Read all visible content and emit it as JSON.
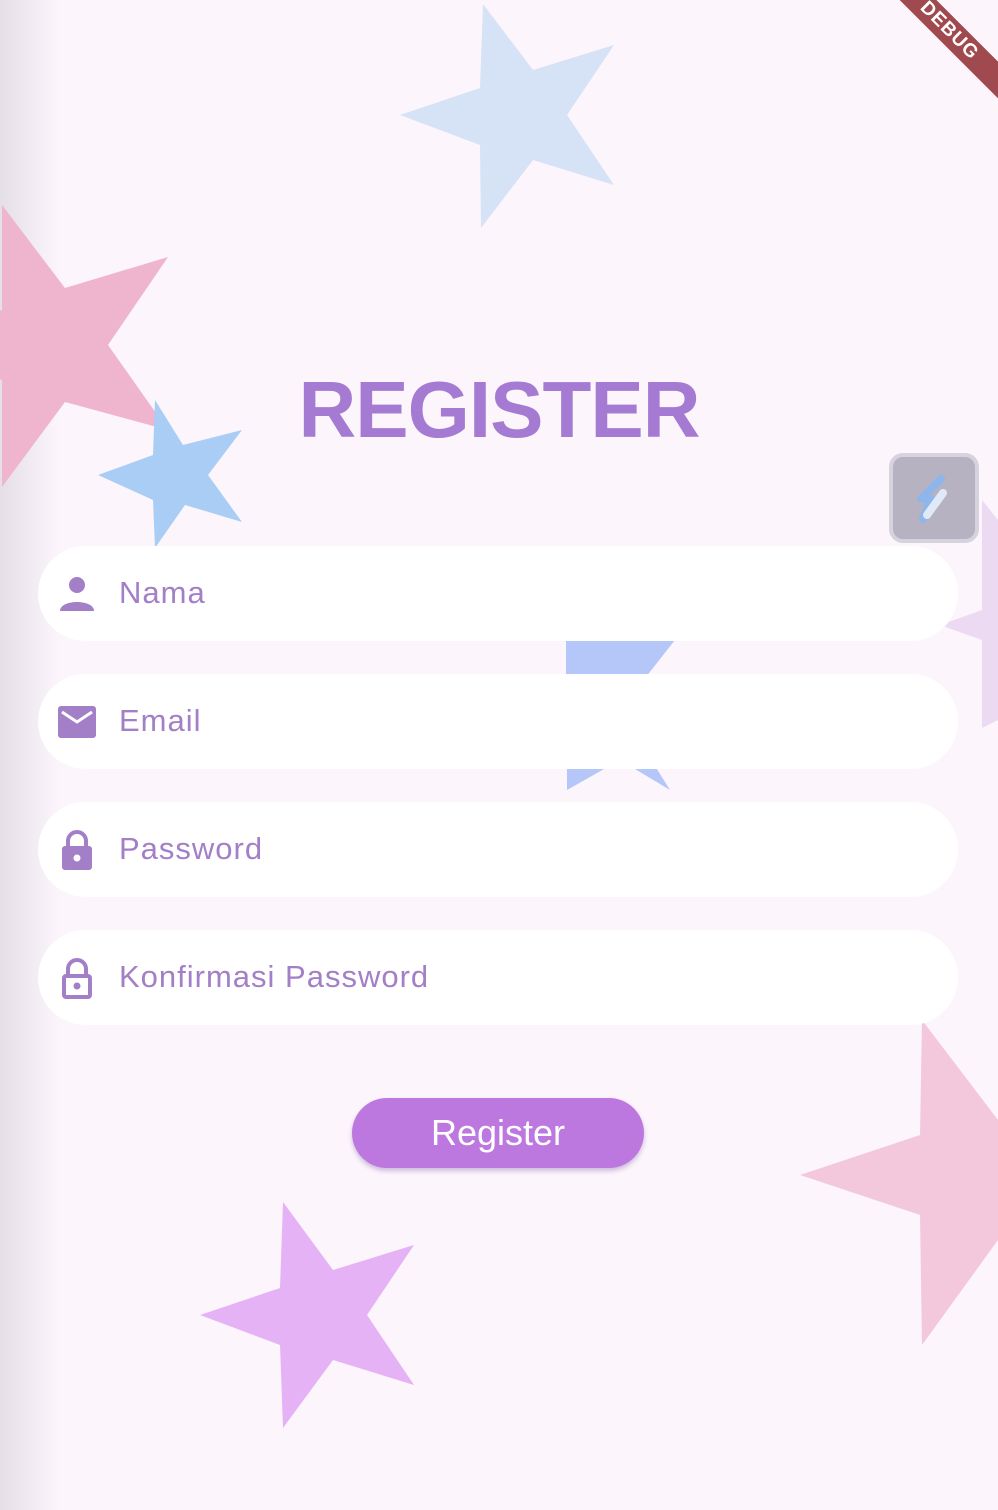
{
  "page": {
    "title": "REGISTER",
    "debug_banner": "DEBUG"
  },
  "form": {
    "fields": [
      {
        "placeholder": "Nama",
        "icon": "person-icon"
      },
      {
        "placeholder": "Email",
        "icon": "mail-icon"
      },
      {
        "placeholder": "Password",
        "icon": "lock-icon"
      },
      {
        "placeholder": "Konfirmasi Password",
        "icon": "lock-outline-icon"
      }
    ],
    "submit_label": "Register"
  },
  "colors": {
    "primary": "#a57ad2",
    "button": "#bd78e0",
    "background": "#fcf5fc",
    "field_background": "#ffffff"
  }
}
